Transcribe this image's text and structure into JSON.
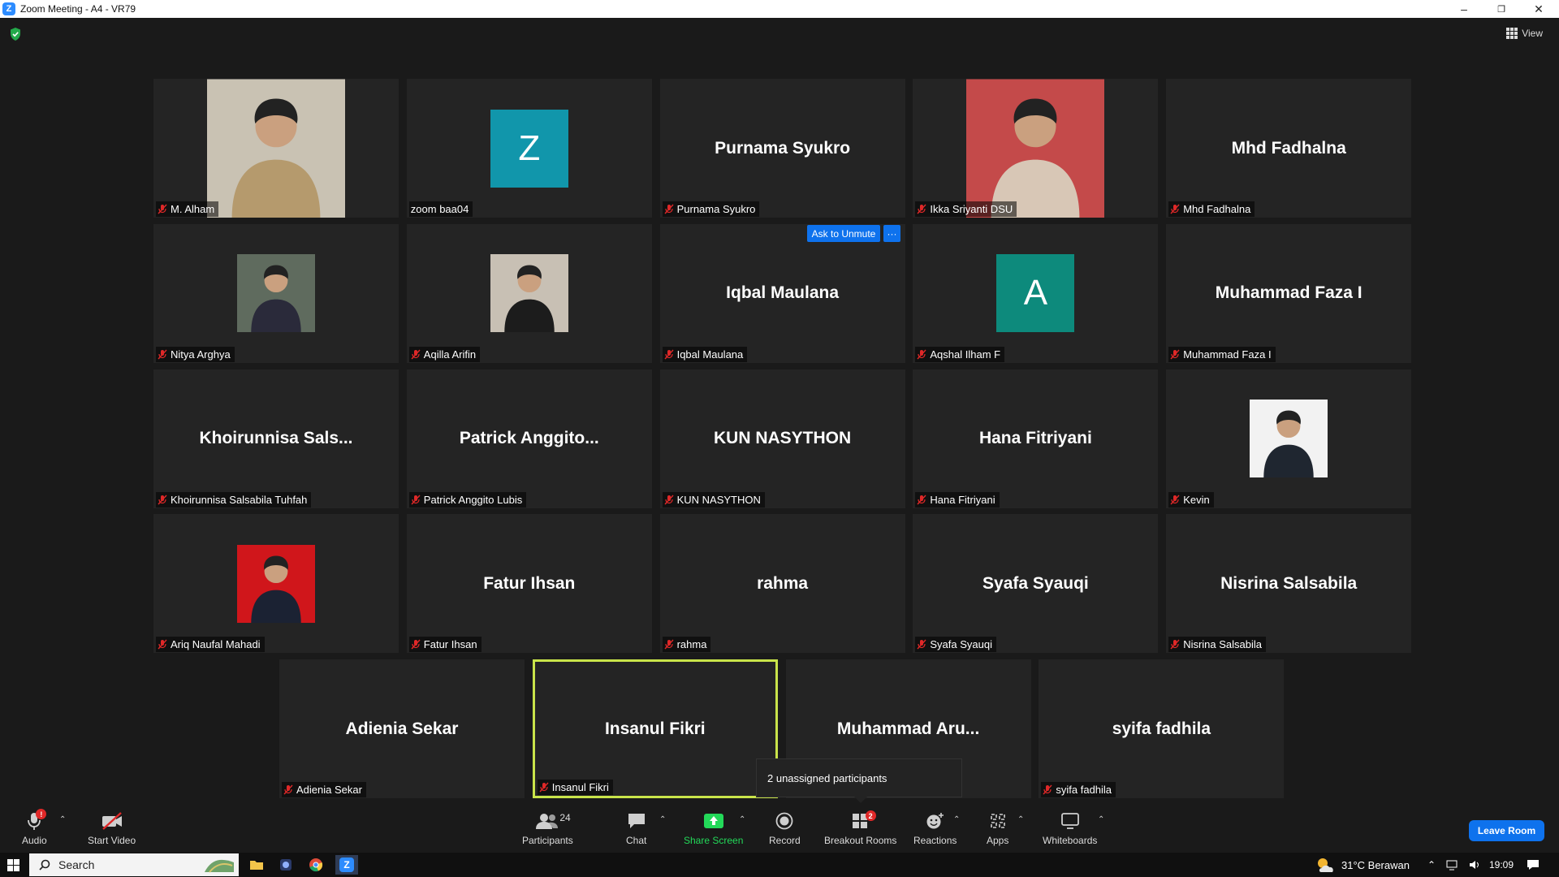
{
  "window": {
    "title": "Zoom Meeting - A4 - VR79",
    "logo_letter": "Z",
    "minimize": "–",
    "restore": "❐",
    "close": "✕"
  },
  "top": {
    "view_label": "View"
  },
  "tiles": [
    {
      "name": "M. Alham",
      "display": "",
      "muted": true,
      "kind": "photo",
      "photo_color": "#c9c2b3",
      "shirt_color": "#b59a6d"
    },
    {
      "name": "zoom baa04",
      "display": "",
      "muted": false,
      "kind": "letter",
      "letter": "Z",
      "color": "#1196ab"
    },
    {
      "name": "Purnama Syukro",
      "display": "Purnama Syukro",
      "muted": true,
      "kind": "text"
    },
    {
      "name": "Ikka Sriyanti DSU",
      "display": "",
      "muted": true,
      "kind": "photo",
      "photo_color": "#c44a4a",
      "shirt_color": "#d8c7b6"
    },
    {
      "name": "Mhd Fadhalna",
      "display": "Mhd Fadhalna",
      "muted": true,
      "kind": "text"
    },
    {
      "name": "Nitya Arghya",
      "display": "",
      "muted": true,
      "kind": "photo",
      "photo_color": "#5f6b5e",
      "shirt_color": "#2a2a3a"
    },
    {
      "name": "Aqilla Arifin",
      "display": "",
      "muted": true,
      "kind": "photo",
      "photo_color": "#c8c0b4",
      "shirt_color": "#1c1c1c"
    },
    {
      "name": "Iqbal Maulana",
      "display": "Iqbal Maulana",
      "muted": true,
      "kind": "text"
    },
    {
      "name": "Aqshal Ilham F",
      "display": "",
      "muted": true,
      "kind": "letter",
      "letter": "A",
      "color": "#0d8a7c"
    },
    {
      "name": "Muhammad Faza I",
      "display": "Muhammad Faza I",
      "muted": true,
      "kind": "text"
    },
    {
      "name": "Khoirunnisa Salsabila Tuhfah",
      "display": "Khoirunnisa  Sals...",
      "muted": true,
      "kind": "text"
    },
    {
      "name": "Patrick Anggito Lubis",
      "display": "Patrick  Anggito...",
      "muted": true,
      "kind": "text"
    },
    {
      "name": "KUN NASYTHON",
      "display": "KUN NASYTHON",
      "muted": true,
      "kind": "text"
    },
    {
      "name": "Hana Fitriyani",
      "display": "Hana Fitriyani",
      "muted": true,
      "kind": "text"
    },
    {
      "name": "Kevin",
      "display": "",
      "muted": true,
      "kind": "photo",
      "photo_color": "#f2f2f2",
      "shirt_color": "#1f2630"
    },
    {
      "name": "Ariq Naufal Mahadi",
      "display": "",
      "muted": true,
      "kind": "photo",
      "photo_color": "#d0161b",
      "shirt_color": "#1b2233"
    },
    {
      "name": "Fatur Ihsan",
      "display": "Fatur Ihsan",
      "muted": true,
      "kind": "text"
    },
    {
      "name": "rahma",
      "display": "rahma",
      "muted": true,
      "kind": "text"
    },
    {
      "name": "Syafa Syauqi",
      "display": "Syafa Syauqi",
      "muted": true,
      "kind": "text"
    },
    {
      "name": "Nisrina Salsabila",
      "display": "Nisrina Salsabila",
      "muted": true,
      "kind": "text"
    },
    {
      "name": "Adienia Sekar",
      "display": "Adienia Sekar",
      "muted": true,
      "kind": "text"
    },
    {
      "name": "Insanul Fikri",
      "display": "Insanul Fikri",
      "muted": true,
      "kind": "text",
      "active": true
    },
    {
      "name": "Muhammad Arung",
      "display": "Muhammad  Aru...",
      "muted": true,
      "kind": "text",
      "hide_label": true
    },
    {
      "name": "syifa fadhila",
      "display": "syifa fadhila",
      "muted": true,
      "kind": "text"
    }
  ],
  "ask_to_unmute": {
    "label": "Ask to Unmute",
    "more": "···"
  },
  "tooltip": {
    "text": "2 unassigned participants"
  },
  "toolbar": {
    "audio": "Audio",
    "audio_badge": "!",
    "start_video": "Start Video",
    "participants": "Participants",
    "participant_count": "24",
    "chat": "Chat",
    "share_screen": "Share Screen",
    "record": "Record",
    "breakout_rooms": "Breakout Rooms",
    "breakout_badge": "2",
    "reactions": "Reactions",
    "apps": "Apps",
    "whiteboards": "Whiteboards",
    "leave": "Leave Room",
    "accent_green": "#23d959",
    "accent_blue": "#0e72ed"
  },
  "taskbar": {
    "search_placeholder": "Search",
    "weather": "31°C  Berawan",
    "time": "19:09"
  }
}
